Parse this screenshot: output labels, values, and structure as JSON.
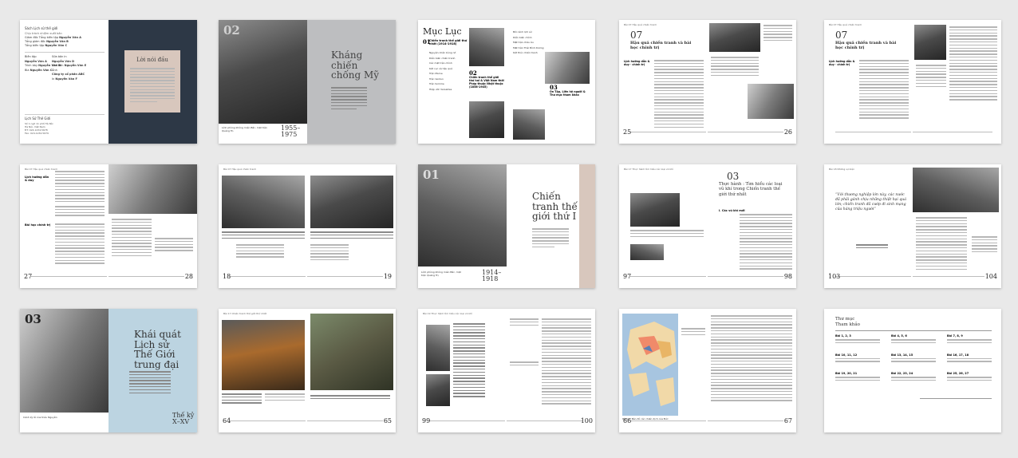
{
  "spreads": [
    {
      "left": {
        "header": "Sách Lịch sử thế giới",
        "credit1_label": "Chịu trách nhiệm xuất bản",
        "credits_top": [
          {
            "role": "Giám đốc Tổng biên tập",
            "name": "Nguyễn Văn A"
          },
          {
            "role": "Tổng giám đốc",
            "name": "Nguyễn Văn B"
          },
          {
            "role": "Tổng biên tập",
            "name": "Nguyễn Văn C"
          }
        ],
        "credits_mid": [
          {
            "role": "Biên tập",
            "name": "Nguyễn Văn A"
          },
          {
            "role": "Trình bày",
            "name": "Nguyễn Văn B"
          },
          {
            "role": "Bìa",
            "name": "Nguyễn Văn C"
          },
          {
            "role": "Sửa bản in",
            "name": "Nguyễn Văn D"
          },
          {
            "role": "Chế bản",
            "name": "Nguyễn Văn E"
          },
          {
            "role": "Ảnh",
            "name": "Công ty cổ phần ABC"
          },
          {
            "role": "In",
            "name": "Nguyễn Văn F"
          }
        ],
        "footer_title": "Lịch Sử Thế Giới",
        "footer_lines": [
          "Số 1 ngõ 11 phố Hà Nội",
          "Hà Nội, Việt Nam",
          "ĐT: 024.1234.5678",
          "Fax: 024.1234.5679"
        ]
      },
      "right": {
        "title": "Lời nói đầu"
      }
    },
    {
      "left": {
        "number": "02",
        "caption": "Lính phòng không miền Bắc, mặt trận Quảng Trị.",
        "years": "1955–1975"
      },
      "right": {
        "title": "Kháng chiến chống Mỹ"
      }
    },
    {
      "left": {
        "title": "Mục Lục",
        "num1": "01",
        "sec1": "Chiến tranh thế giới thứ nhất (1914-1918)",
        "entries": [
          "Nguyên nhân bùng nổ",
          "Diễn biến chiến tranh",
          "Các mặt trận chính",
          "Kết cục và hậu quả",
          "Trận Marne",
          "Trận Verdun",
          "Trận Somme",
          "Hiệp ước Versailles"
        ]
      },
      "right": {
        "num2": "02",
        "sec2": "Chiến tranh thế giới thứ hai & Việt Nam thời Pháp thuộc Nhật thuộc (1858-1945)",
        "num3": "03",
        "sec3": "Ôn Tập, Liên hệ người & Thư mục tham khảo",
        "entries": [
          "Bối cảnh lịch sử",
          "Diễn biến chính",
          "Mặt trận châu Âu",
          "Mặt trận Thái Bình Dương",
          "Kết thúc chiến tranh"
        ]
      }
    },
    {
      "left": {
        "header": "Bài 07 Hậu quả chiến tranh",
        "number": "07",
        "title": "Hậu quả chiến tranh và bài học chính trị",
        "subtitle": "Lịch hướng dẫn & duy · chính trị",
        "pnum": "25"
      },
      "right": {
        "pnum": "26"
      }
    },
    {
      "left": {
        "header": "Bài 07 Hậu quả chiến tranh",
        "number": "07",
        "title": "Hậu quả chiến tranh và bài học chính trị",
        "subtitle": "Lịch hướng dẫn & duy · chính trị"
      },
      "right": {}
    },
    {
      "left": {
        "header": "Bài 07 Hậu quả chiến tranh",
        "section": "Lịch hướng dẫn & duy",
        "section2": "Bài học chính trị",
        "pnum": "27"
      },
      "right": {
        "pnum": "28"
      }
    },
    {
      "left": {
        "header": "Bài 07 Hậu quả chiến tranh",
        "pnum": "18"
      },
      "right": {
        "pnum": "19"
      }
    },
    {
      "left": {
        "number": "01",
        "caption": "Lính phòng không miền Bắc, mặt trận Quảng Trị.",
        "years": "1914–1918"
      },
      "right": {
        "title": "Chiến tranh thế giới thứ I"
      }
    },
    {
      "left": {
        "header": "Bài 17 Thực hành tìm hiểu các loại vũ khí",
        "pnum": "97"
      },
      "right": {
        "number": "03",
        "title": "Thực hành : Tìm hiểu các loại vũ khí trong Chiến tranh thế giới thứ nhất",
        "label": "I. Các vũ khí mới",
        "pnum": "98"
      }
    },
    {
      "left": {
        "header": "Bài 18 Những sự kiện",
        "quote": "“Với thương nghiệp lớn này, các nước đã phải gánh chịu những thiệt hại quá lớn; chiến tranh đã cướp đi sinh mạng của hàng triệu người”",
        "pnum": "103"
      },
      "right": {
        "pnum": "104"
      }
    },
    {
      "left": {
        "number": "03",
        "caption": "Cảnh kỳ lễ của triều Nguyễn"
      },
      "right": {
        "title": "Khái quát Lịch sử Thế Giới trung đại",
        "subtitle": "Thế kỷ X–XV"
      }
    },
    {
      "left": {
        "header": "Bài 17 Chiến tranh thế giới thứ nhất",
        "pnum": "64"
      },
      "right": {
        "pnum": "65"
      }
    },
    {
      "left": {
        "header": "Bài 19 Thực hành tìm hiểu các loại vũ khí",
        "pnum": "99"
      },
      "right": {
        "pnum": "100"
      }
    },
    {
      "left": {
        "caption": "Hình 1: Bản đồ các chiến dịch của Đức",
        "pnum": "66"
      },
      "right": {
        "pnum": "67"
      }
    },
    {
      "left": {
        "title": "Thư mục Tham khảo",
        "refs": [
          "Bài 1, 2, 3",
          "Bài 4, 5, 6",
          "Bài 7, 8, 9",
          "Bài 10, 11, 12",
          "Bài 13, 14, 15",
          "Bài 16, 17, 18",
          "Bài 19, 20, 21",
          "Bài 22, 23, 24",
          "Bài 25, 26, 27"
        ]
      },
      "right": {}
    }
  ],
  "colors": {
    "dark_navy": "#2d3846",
    "grey_block": "#bdbec0",
    "beige": "#d8c7bd",
    "light_blue": "#bcd4e1",
    "map_blue": "#a7c5e0"
  }
}
